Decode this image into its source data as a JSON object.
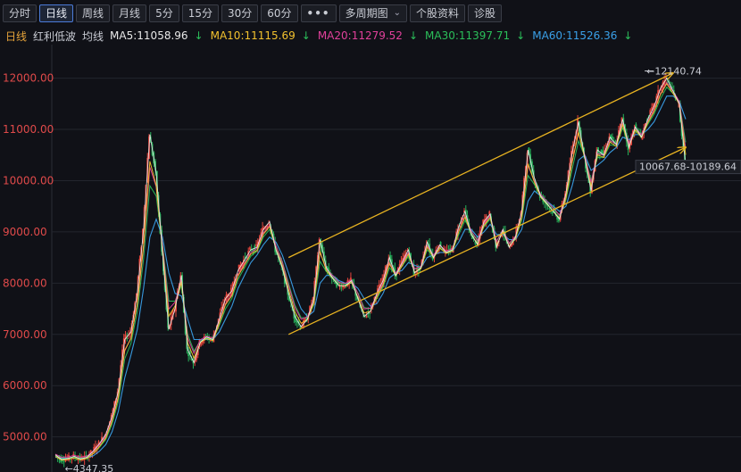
{
  "toolbar": {
    "tabs": [
      {
        "label": "分时",
        "active": false
      },
      {
        "label": "日线",
        "active": true
      },
      {
        "label": "周线",
        "active": false
      },
      {
        "label": "月线",
        "active": false
      },
      {
        "label": "5分",
        "active": false
      },
      {
        "label": "15分",
        "active": false
      },
      {
        "label": "30分",
        "active": false
      },
      {
        "label": "60分",
        "active": false
      }
    ],
    "more_label": "•••",
    "multi_period_label": "多周期图",
    "stock_info_label": "个股资料",
    "diagnose_label": "诊股"
  },
  "indicators": {
    "period": "日线",
    "name": "红利低波",
    "type": "均线",
    "ma": [
      {
        "label": "MA5:11058.96",
        "color": "#e8e8e8",
        "arrow_color": "#2bbf5a"
      },
      {
        "label": "MA10:11115.69",
        "color": "#f2c12e",
        "arrow_color": "#2bbf5a"
      },
      {
        "label": "MA20:11279.52",
        "color": "#e0409a",
        "arrow_color": "#2bbf5a"
      },
      {
        "label": "MA30:11397.71",
        "color": "#2bbf5a",
        "arrow_color": "#2bbf5a"
      },
      {
        "label": "MA60:11526.36",
        "color": "#3aa0e8",
        "arrow_color": "#2bbf5a"
      }
    ],
    "arrow": "↓"
  },
  "chart_data": {
    "type": "line",
    "ylim": [
      4350,
      12150
    ],
    "y_ticks": [
      "12000.00",
      "11000.00",
      "10000.00",
      "9000.00",
      "8000.00",
      "7000.00",
      "6000.00",
      "5000.00"
    ],
    "y_tick_values": [
      12000,
      11000,
      10000,
      9000,
      8000,
      7000,
      6000,
      5000
    ],
    "annotations": {
      "high": "12140.74",
      "low": "4347.35",
      "current_range": "10067.68-10189.64"
    },
    "x_index_max": 100,
    "series": [
      {
        "role": "close",
        "x": [
          0,
          1,
          2,
          3,
          4,
          5,
          6,
          7,
          8,
          9,
          10,
          11,
          12,
          13,
          14,
          15,
          16,
          17,
          18,
          19,
          20,
          21,
          22,
          23,
          24,
          25,
          26,
          27,
          28,
          29,
          30,
          31,
          32,
          33,
          34,
          35,
          36,
          37,
          38,
          39,
          40,
          41,
          42,
          43,
          44,
          45,
          46,
          47,
          48,
          49,
          50,
          51,
          52,
          53,
          54,
          55,
          56,
          57,
          58,
          59,
          60,
          61,
          62,
          63,
          64,
          65,
          66,
          67,
          68,
          69,
          70,
          71,
          72,
          73,
          74,
          75,
          76,
          77,
          78,
          79,
          80,
          81,
          82,
          83,
          84,
          85,
          86,
          87,
          88,
          89,
          90,
          91,
          92,
          93,
          94,
          95,
          96,
          97,
          98,
          99,
          100
        ],
        "values": [
          4650,
          4560,
          4580,
          4620,
          4570,
          4600,
          4720,
          4870,
          5050,
          5400,
          5900,
          6900,
          7050,
          7800,
          9050,
          10900,
          10150,
          8600,
          7100,
          7500,
          8150,
          6700,
          6450,
          6850,
          6950,
          6900,
          7300,
          7700,
          7850,
          8250,
          8450,
          8650,
          8700,
          9050,
          9200,
          8650,
          8300,
          7800,
          7350,
          7150,
          7300,
          7700,
          8850,
          8300,
          8100,
          7950,
          7950,
          8050,
          7700,
          7350,
          7450,
          7800,
          8050,
          8500,
          8150,
          8400,
          8650,
          8200,
          8300,
          8800,
          8500,
          8750,
          8600,
          8650,
          9100,
          9400,
          8950,
          8750,
          9200,
          9350,
          8700,
          9050,
          8700,
          8900,
          9400,
          10600,
          10050,
          9700,
          9550,
          9400,
          9250,
          9750,
          10550,
          11150,
          10450,
          9800,
          10600,
          10500,
          10850,
          10700,
          11200,
          10650,
          11050,
          10850,
          11200,
          11450,
          11800,
          12000,
          11750,
          11500,
          10300
        ]
      },
      {
        "role": "ma_slow",
        "values": [
          4600,
          4590,
          4585,
          4590,
          4585,
          4590,
          4630,
          4720,
          4850,
          5100,
          5500,
          6150,
          6600,
          7100,
          7900,
          8900,
          9250,
          8900,
          8200,
          7800,
          7750,
          7300,
          6900,
          6900,
          6900,
          6900,
          7050,
          7300,
          7550,
          7900,
          8150,
          8400,
          8550,
          8750,
          8900,
          8800,
          8550,
          8200,
          7800,
          7500,
          7350,
          7450,
          8000,
          8150,
          8150,
          8050,
          8000,
          8000,
          7900,
          7700,
          7550,
          7600,
          7800,
          8100,
          8200,
          8250,
          8400,
          8350,
          8300,
          8500,
          8550,
          8600,
          8600,
          8620,
          8800,
          9050,
          9050,
          8900,
          9000,
          9150,
          8950,
          8950,
          8850,
          8850,
          9050,
          9600,
          9800,
          9700,
          9600,
          9500,
          9400,
          9500,
          9900,
          10400,
          10500,
          10200,
          10300,
          10400,
          10550,
          10650,
          10850,
          10800,
          10900,
          10900,
          11000,
          11150,
          11400,
          11650,
          11650,
          11550,
          11200
        ]
      }
    ],
    "channel": {
      "upper": {
        "from": [
          37,
          8500
        ],
        "to": [
          98,
          12100
        ]
      },
      "lower": {
        "from": [
          37,
          7000
        ],
        "to": [
          100,
          10650
        ]
      }
    }
  }
}
